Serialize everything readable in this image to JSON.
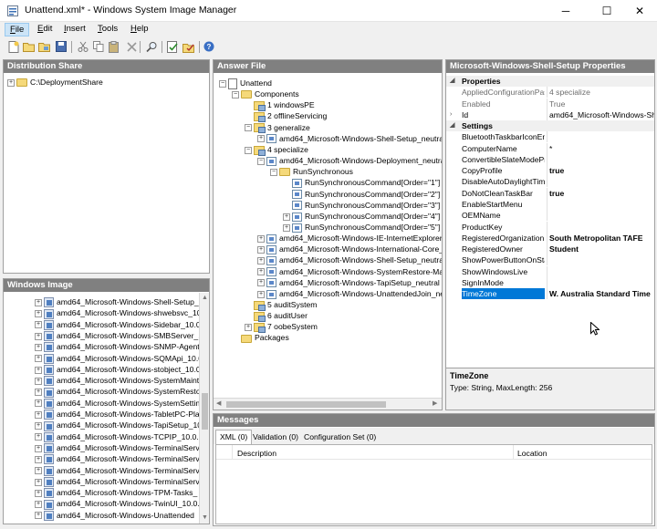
{
  "window": {
    "title": "Unattend.xml* - Windows System Image Manager",
    "buttons": {
      "minimize": "─",
      "maximize": "☐",
      "close": "✕"
    }
  },
  "menu": [
    {
      "pre": "",
      "u": "F",
      "post": "ile"
    },
    {
      "pre": "",
      "u": "E",
      "post": "dit"
    },
    {
      "pre": "",
      "u": "I",
      "post": "nsert"
    },
    {
      "pre": "",
      "u": "T",
      "post": "ools"
    },
    {
      "pre": "",
      "u": "H",
      "post": "elp"
    }
  ],
  "toolbar_icons": [
    "new-icon",
    "open-icon",
    "open-folder-icon",
    "save-icon",
    "cut-icon",
    "copy-icon",
    "paste-icon",
    "delete-icon",
    "find-icon",
    "validate-icon",
    "create-config-set-icon",
    "help-icon"
  ],
  "distribution_share": {
    "header": "Distribution Share",
    "root": "C:\\DeploymentShare"
  },
  "windows_image": {
    "header": "Windows Image",
    "items": [
      "amd64_Microsoft-Windows-Shell-Setup_1",
      "amd64_Microsoft-Windows-shwebsvc_10.",
      "amd64_Microsoft-Windows-Sidebar_10.0",
      "amd64_Microsoft-Windows-SMBServer_1",
      "amd64_Microsoft-Windows-SNMP-Agent-",
      "amd64_Microsoft-Windows-SQMApi_10.0",
      "amd64_Microsoft-Windows-stobject_10.0",
      "amd64_Microsoft-Windows-SystemMainte",
      "amd64_Microsoft-Windows-SystemRestor",
      "amd64_Microsoft-Windows-SystemSetting",
      "amd64_Microsoft-Windows-TabletPC-Plat",
      "amd64_Microsoft-Windows-TapiSetup_10.",
      "amd64_Microsoft-Windows-TCPIP_10.0.1",
      "amd64_Microsoft-Windows-TerminalServi",
      "amd64_Microsoft-Windows-TerminalServi",
      "amd64_Microsoft-Windows-TerminalServi",
      "amd64_Microsoft-Windows-TerminalServi",
      "amd64_Microsoft-Windows-TPM-Tasks_",
      "amd64_Microsoft-Windows-TwinUI_10.0.",
      "amd64_Microsoft-Windows-Unattended"
    ]
  },
  "answer_file": {
    "header": "Answer File",
    "nodes": [
      {
        "label": "Unattend",
        "level": 0,
        "icon": "doc",
        "exp": "-"
      },
      {
        "label": "Components",
        "level": 1,
        "icon": "folder",
        "exp": "-"
      },
      {
        "label": "1 windowsPE",
        "level": 2,
        "icon": "pass",
        "exp": ""
      },
      {
        "label": "2 offlineServicing",
        "level": 2,
        "icon": "pass",
        "exp": ""
      },
      {
        "label": "3 generalize",
        "level": 2,
        "icon": "pass",
        "exp": "-"
      },
      {
        "label": "amd64_Microsoft-Windows-Shell-Setup_neutral",
        "level": 3,
        "icon": "comp",
        "exp": "+"
      },
      {
        "label": "4 specialize",
        "level": 2,
        "icon": "pass",
        "exp": "-"
      },
      {
        "label": "amd64_Microsoft-Windows-Deployment_neutral",
        "level": 3,
        "icon": "comp",
        "exp": "-"
      },
      {
        "label": "RunSynchronous",
        "level": 4,
        "icon": "folder",
        "exp": "-"
      },
      {
        "label": "RunSynchronousCommand[Order=\"1\"]",
        "level": 5,
        "icon": "comp",
        "exp": ""
      },
      {
        "label": "RunSynchronousCommand[Order=\"2\"]",
        "level": 5,
        "icon": "comp",
        "exp": ""
      },
      {
        "label": "RunSynchronousCommand[Order=\"3\"]",
        "level": 5,
        "icon": "comp",
        "exp": ""
      },
      {
        "label": "RunSynchronousCommand[Order=\"4\"]",
        "level": 5,
        "icon": "comp",
        "exp": "+"
      },
      {
        "label": "RunSynchronousCommand[Order=\"5\"]",
        "level": 5,
        "icon": "comp",
        "exp": "+"
      },
      {
        "label": "amd64_Microsoft-Windows-IE-InternetExplorer_n",
        "level": 3,
        "icon": "comp",
        "exp": "+"
      },
      {
        "label": "amd64_Microsoft-Windows-International-Core_ne",
        "level": 3,
        "icon": "comp",
        "exp": "+"
      },
      {
        "label": "amd64_Microsoft-Windows-Shell-Setup_neutral",
        "level": 3,
        "icon": "comp",
        "exp": "+"
      },
      {
        "label": "amd64_Microsoft-Windows-SystemRestore-Main",
        "level": 3,
        "icon": "comp",
        "exp": "+"
      },
      {
        "label": "amd64_Microsoft-Windows-TapiSetup_neutral",
        "level": 3,
        "icon": "comp",
        "exp": "+"
      },
      {
        "label": "amd64_Microsoft-Windows-UnattendedJoin_neu",
        "level": 3,
        "icon": "comp",
        "exp": "+"
      },
      {
        "label": "5 auditSystem",
        "level": 2,
        "icon": "pass",
        "exp": ""
      },
      {
        "label": "6 auditUser",
        "level": 2,
        "icon": "pass",
        "exp": ""
      },
      {
        "label": "7 oobeSystem",
        "level": 2,
        "icon": "pass",
        "exp": "+"
      },
      {
        "label": "Packages",
        "level": 1,
        "icon": "folder",
        "exp": ""
      }
    ]
  },
  "properties": {
    "header": "Microsoft-Windows-Shell-Setup Properties",
    "rows": [
      {
        "type": "group",
        "name": "Properties",
        "value": "",
        "exp": "▲"
      },
      {
        "type": "prop",
        "name": "AppliedConfigurationPas",
        "value": "4 specialize",
        "gray": true
      },
      {
        "type": "prop",
        "name": "Enabled",
        "value": "True",
        "gray": true
      },
      {
        "type": "prop",
        "name": "Id",
        "value": "amd64_Microsoft-Windows-Shel",
        "exp": ">"
      },
      {
        "type": "group",
        "name": "Settings",
        "value": "",
        "exp": "▲"
      },
      {
        "type": "prop",
        "name": "BluetoothTaskbarIconEn",
        "value": ""
      },
      {
        "type": "prop",
        "name": "ComputerName",
        "value": "*"
      },
      {
        "type": "prop",
        "name": "ConvertibleSlateModePr",
        "value": ""
      },
      {
        "type": "prop",
        "name": "CopyProfile",
        "value": "true",
        "bold": true
      },
      {
        "type": "prop",
        "name": "DisableAutoDaylightTime",
        "value": ""
      },
      {
        "type": "prop",
        "name": "DoNotCleanTaskBar",
        "value": "true",
        "bold": true
      },
      {
        "type": "prop",
        "name": "EnableStartMenu",
        "value": ""
      },
      {
        "type": "prop",
        "name": "OEMName",
        "value": ""
      },
      {
        "type": "prop",
        "name": "ProductKey",
        "value": ""
      },
      {
        "type": "prop",
        "name": "RegisteredOrganization",
        "value": "South Metropolitan TAFE",
        "bold": true
      },
      {
        "type": "prop",
        "name": "RegisteredOwner",
        "value": "Student",
        "bold": true
      },
      {
        "type": "prop",
        "name": "ShowPowerButtonOnSta",
        "value": ""
      },
      {
        "type": "prop",
        "name": "ShowWindowsLive",
        "value": ""
      },
      {
        "type": "prop",
        "name": "SignInMode",
        "value": ""
      },
      {
        "type": "prop",
        "name": "TimeZone",
        "value": "W. Australia Standard Time",
        "bold": true,
        "selected": true
      }
    ],
    "desc_title": "TimeZone",
    "desc_text": "Type: String, MaxLength: 256"
  },
  "messages": {
    "header": "Messages",
    "tabs": [
      "XML (0)",
      "Validation (0)",
      "Configuration Set (0)"
    ],
    "columns": [
      "Description",
      "Location"
    ]
  }
}
